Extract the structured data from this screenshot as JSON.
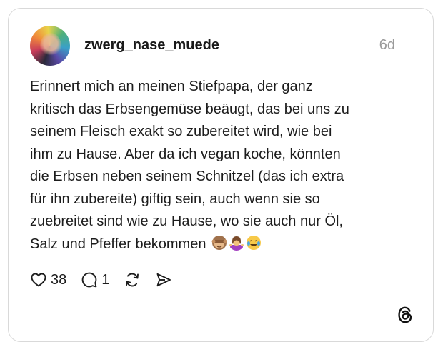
{
  "post": {
    "username": "zwerg_nase_muede",
    "time": "6d",
    "lines": [
      "Erinnert mich an meinen Stiefpapa, der ganz",
      "kritisch das Erbsengemüse beäugt, das bei uns zu",
      "seinem Fleisch exakt so zubereitet wird, wie bei",
      "ihm zu Hause. Aber da ich vegan koche, könnten",
      "die Erbsen neben seinem Schnitzel (das ich extra",
      "für ihn zubereite) giftig sein, auch wenn sie so",
      "zuebreitet sind wie zu Hause, wo sie auch nur Öl,",
      "Salz und Pfeffer bekommen"
    ],
    "emojis": [
      "see-no-evil-monkey",
      "woman-shrugging",
      "face-with-tears-of-joy"
    ],
    "likes": "38",
    "replies": "1"
  },
  "icons": [
    "avatar",
    "heart-icon",
    "comment-icon",
    "repost-icon",
    "share-icon",
    "threads-logo-icon"
  ],
  "colors": {
    "text": "#1c1c1c",
    "muted": "#9a9a9a",
    "border": "#d9d9d9"
  }
}
